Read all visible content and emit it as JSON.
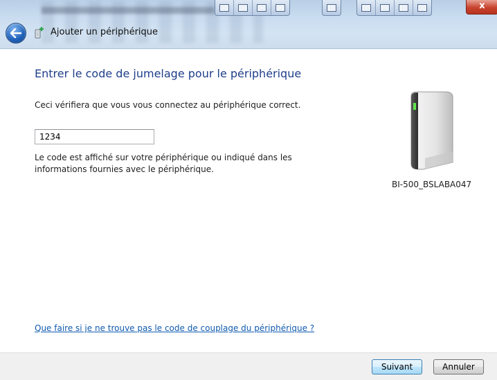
{
  "window": {
    "title": "Ajouter un périphérique",
    "close_glyph": "x"
  },
  "icons": {
    "back": "back-arrow-icon",
    "wizard": "add-device-icon",
    "device": "external-drive-icon"
  },
  "main": {
    "heading": "Entrer le code de jumelage pour le périphérique",
    "description": "Ceci vérifiera que vous vous connectez au périphérique correct.",
    "code_value": "1234",
    "hint": "Le code est affiché sur votre périphérique ou indiqué dans les informations fournies avec le périphérique.",
    "device_name": "BI-500_BSLABA047",
    "help_link": "Que faire si je ne trouve pas le code de couplage du périphérique ?"
  },
  "footer": {
    "next_label": "Suivant",
    "cancel_label": "Annuler"
  },
  "colors": {
    "heading": "#1e3e8a",
    "link": "#0f5ab0",
    "primary_button": "#bee6fd",
    "close_button": "#c7432e"
  }
}
